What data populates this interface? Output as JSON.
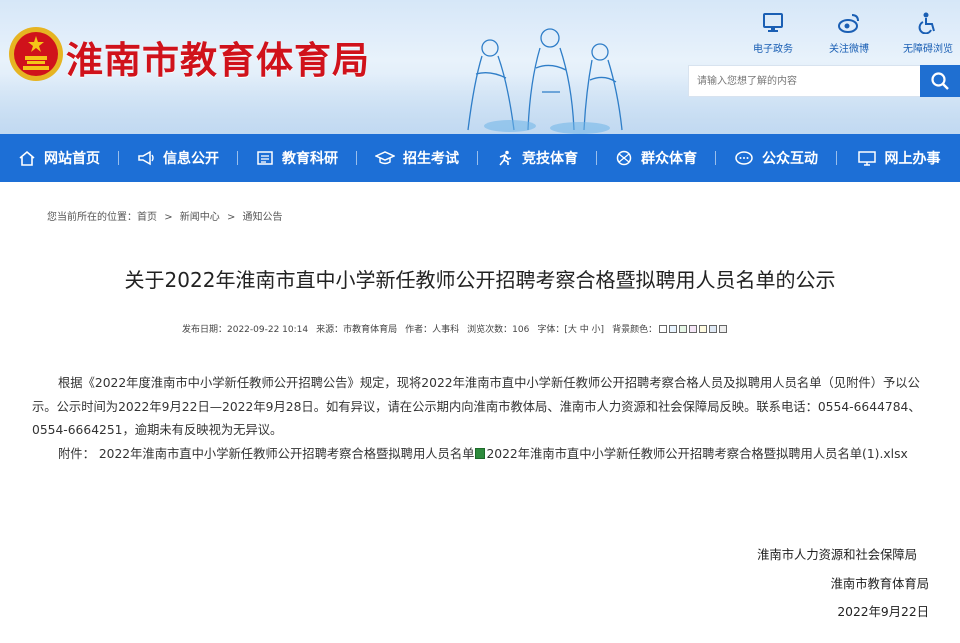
{
  "site": {
    "title": "淮南市教育体育局"
  },
  "quick_links": [
    {
      "label": "电子政务",
      "icon": "monitor-icon"
    },
    {
      "label": "关注微博",
      "icon": "weibo-icon"
    },
    {
      "label": "无障碍浏览",
      "icon": "accessibility-icon"
    }
  ],
  "search": {
    "placeholder": "请输入您想了解的内容"
  },
  "nav": [
    {
      "label": "网站首页",
      "icon": "home-icon"
    },
    {
      "label": "信息公开",
      "icon": "megaphone-icon"
    },
    {
      "label": "教育科研",
      "icon": "document-icon"
    },
    {
      "label": "招生考试",
      "icon": "graduation-cap-icon"
    },
    {
      "label": "竞技体育",
      "icon": "runner-icon"
    },
    {
      "label": "群众体育",
      "icon": "ball-icon"
    },
    {
      "label": "公众互动",
      "icon": "chat-icon"
    },
    {
      "label": "网上办事",
      "icon": "desktop-icon"
    }
  ],
  "breadcrumb": {
    "prefix": "您当前所在的位置：",
    "items": [
      "首页",
      "新闻中心",
      "通知公告"
    ],
    "sep": ">"
  },
  "article": {
    "title": "关于2022年淮南市直中小学新任教师公开招聘考察合格暨拟聘用人员名单的公示",
    "meta": {
      "date": "发布日期：2022-09-22 10:14",
      "source": "来源：市教育体育局",
      "author": "作者：人事科",
      "views": "浏览次数：106",
      "font_size": "字体：[大 中 小]",
      "bg_color_label": "背景颜色：",
      "bg_colors": [
        "#ffffff",
        "#e8f4ff",
        "#e6f7e6",
        "#f5e6f7",
        "#fffbe0",
        "#dfe9f5",
        "#eeeeee"
      ]
    },
    "paragraph": "根据《2022年度淮南市中小学新任教师公开招聘公告》规定，现将2022年淮南市直中小学新任教师公开招聘考察合格人员及拟聘用人员名单（见附件）予以公示。公示时间为2022年9月22日—2022年9月28日。如有异议，请在公示期内向淮南市教体局、淮南市人力资源和社会保障局反映。联系电话：0554-6644784、0554-6664251，逾期未有反映视为无异议。",
    "attachment_label": "附件：",
    "attachment_name": "2022年淮南市直中小学新任教师公开招聘考察合格暨拟聘用人员名单",
    "attachment_file": "2022年淮南市直中小学新任教师公开招聘考察合格暨拟聘用人员名单(1).xlsx",
    "signatures": [
      "淮南市人力资源和社会保障局",
      "淮南市教育体育局",
      "2022年9月22日"
    ]
  },
  "colors": {
    "nav_bg": "#1d6fd6",
    "title_red": "#d0121b"
  }
}
